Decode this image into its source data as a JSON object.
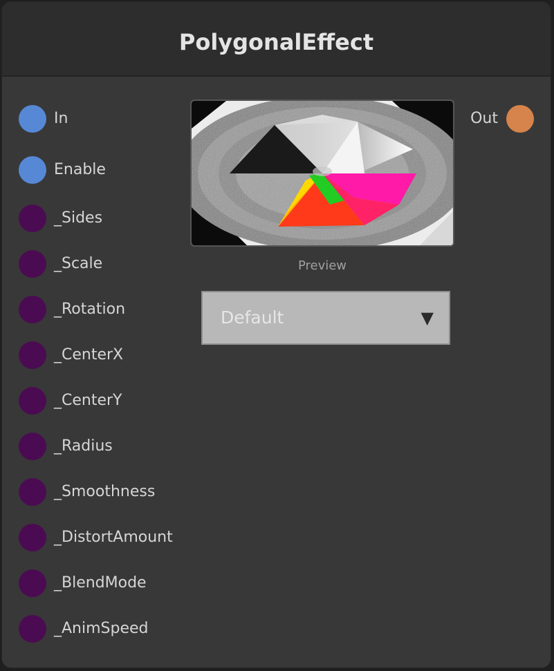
{
  "node": {
    "title": "PolygonalEffect"
  },
  "inputs": [
    {
      "label": "In",
      "type": "flow",
      "color": "#5788d6"
    },
    {
      "label": "Enable",
      "type": "flow",
      "color": "#5788d6"
    },
    {
      "label": "_Sides",
      "type": "param",
      "color": "#4b0b52"
    },
    {
      "label": "_Scale",
      "type": "param",
      "color": "#4b0b52"
    },
    {
      "label": "_Rotation",
      "type": "param",
      "color": "#4b0b52"
    },
    {
      "label": "_CenterX",
      "type": "param",
      "color": "#4b0b52"
    },
    {
      "label": "_CenterY",
      "type": "param",
      "color": "#4b0b52"
    },
    {
      "label": "_Radius",
      "type": "param",
      "color": "#4b0b52"
    },
    {
      "label": "_Smoothness",
      "type": "param",
      "color": "#4b0b52"
    },
    {
      "label": "_DistortAmount",
      "type": "param",
      "color": "#4b0b52"
    },
    {
      "label": "_BlendMode",
      "type": "param",
      "color": "#4b0b52"
    },
    {
      "label": "_AnimSpeed",
      "type": "param",
      "color": "#4b0b52"
    }
  ],
  "outputs": [
    {
      "label": "Out",
      "color": "#d6844b"
    }
  ],
  "preview": {
    "caption": "Preview"
  },
  "dropdown": {
    "selected": "Default",
    "caret_icon": "triangle-down-icon",
    "caret_glyph": "▼"
  }
}
